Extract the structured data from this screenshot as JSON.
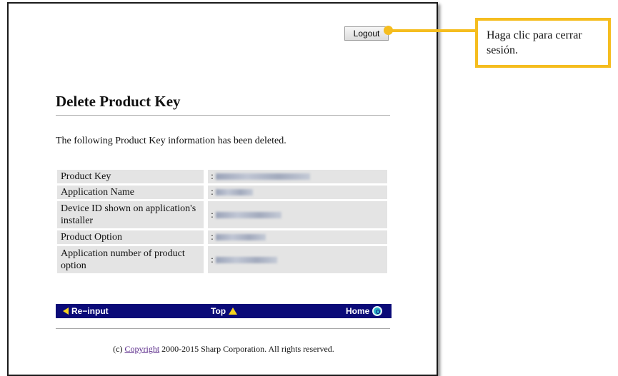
{
  "header": {
    "logout_label": "Logout"
  },
  "page": {
    "title": "Delete Product Key",
    "message": "The following Product Key information has been deleted."
  },
  "info_table": {
    "rows": [
      {
        "label": "Product Key",
        "separator": ":"
      },
      {
        "label": "Application Name",
        "separator": ":"
      },
      {
        "label": "Device ID shown on application's installer",
        "separator": ":"
      },
      {
        "label": "Product Option",
        "separator": ":"
      },
      {
        "label": "Application number of product option",
        "separator": ":"
      }
    ]
  },
  "nav": {
    "reinput_label": "Re−input",
    "top_label": "Top",
    "home_label": "Home",
    "icons": [
      "arrow-left-icon",
      "arrow-up-icon",
      "home-target-icon"
    ],
    "bar_color": "#0b0b78",
    "accent_color": "#f6d31e"
  },
  "footer": {
    "prefix": "(c) ",
    "link_label": "Copyright",
    "suffix": " 2000-2015 Sharp Corporation. All rights reserved."
  },
  "callout": {
    "text": "Haga clic para cerrar sesión.",
    "border_color": "#f5bd1f"
  }
}
